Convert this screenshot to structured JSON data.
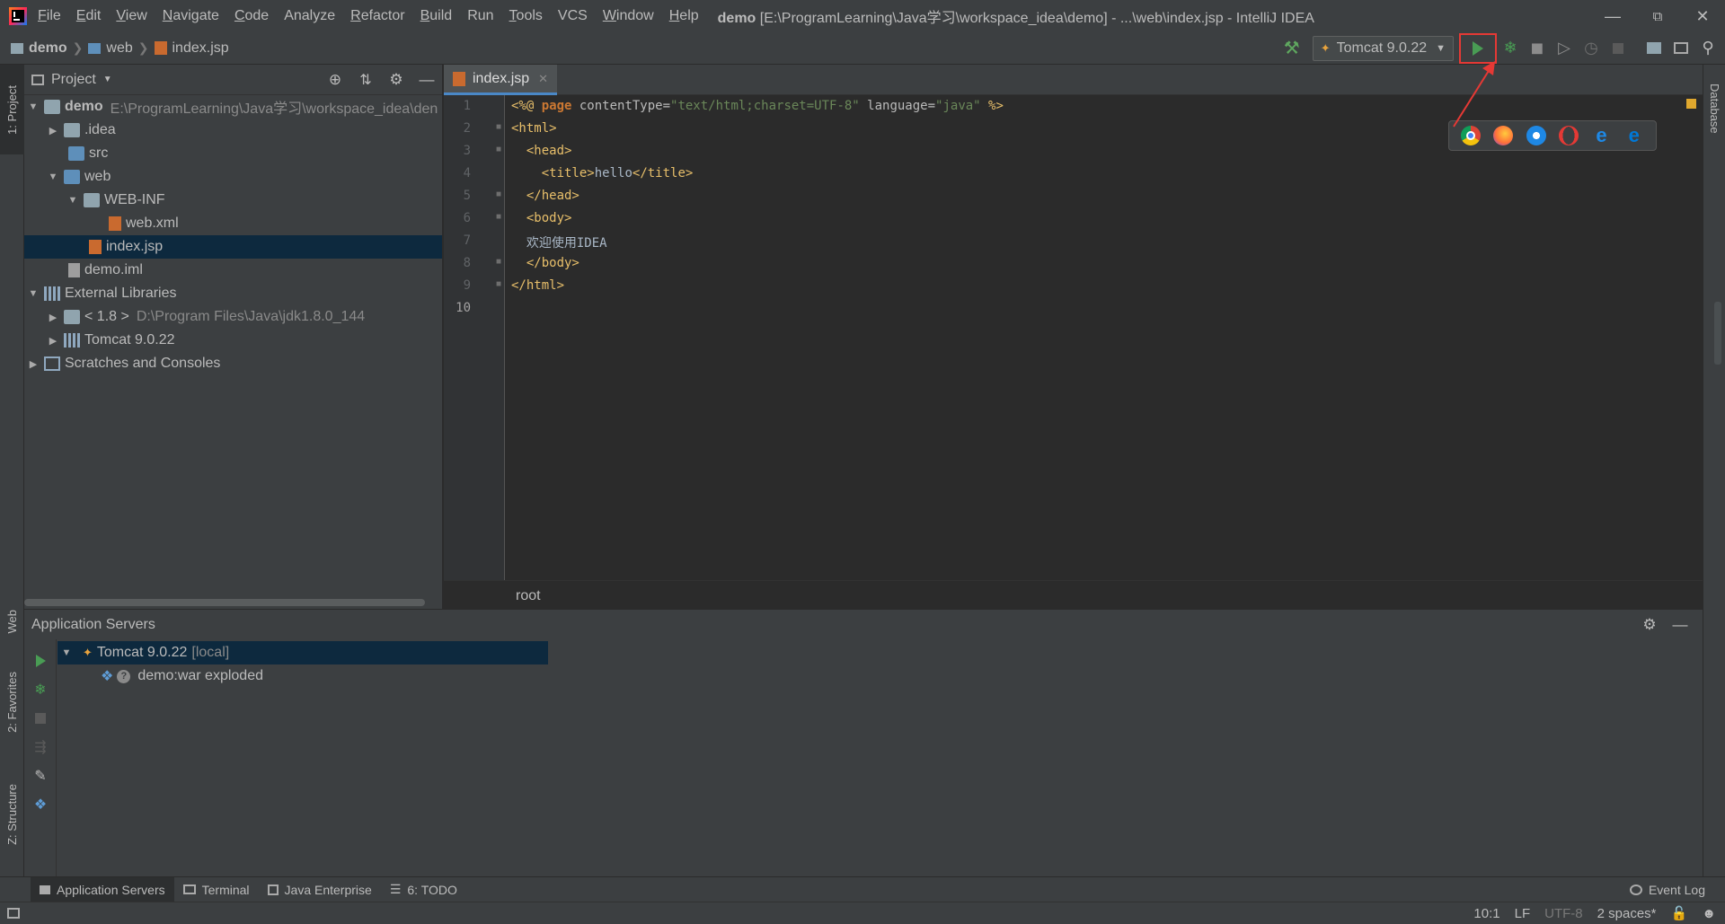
{
  "menu": {
    "items": [
      {
        "label": "File",
        "mn": "F",
        "rest": "ile"
      },
      {
        "label": "Edit",
        "mn": "E",
        "rest": "dit"
      },
      {
        "label": "View",
        "mn": "V",
        "rest": "iew"
      },
      {
        "label": "Navigate",
        "mn": "N",
        "rest": "avigate"
      },
      {
        "label": "Code",
        "mn": "C",
        "rest": "ode"
      },
      {
        "label": "Analyze",
        "mn": "",
        "rest": "Analyze"
      },
      {
        "label": "Refactor",
        "mn": "R",
        "rest": "efactor"
      },
      {
        "label": "Build",
        "mn": "B",
        "rest": "uild"
      },
      {
        "label": "Run",
        "mn": "",
        "rest": "Run"
      },
      {
        "label": "Tools",
        "mn": "T",
        "rest": "ools"
      },
      {
        "label": "VCS",
        "mn": "",
        "rest": "VCS"
      },
      {
        "label": "Window",
        "mn": "W",
        "rest": "indow"
      },
      {
        "label": "Help",
        "mn": "H",
        "rest": "elp"
      }
    ]
  },
  "window": {
    "project": "demo",
    "title_rest": "[E:\\ProgramLearning\\Java学习\\workspace_idea\\demo] - ...\\web\\index.jsp - IntelliJ IDEA"
  },
  "navbar": {
    "crumbs": [
      "demo",
      "web",
      "index.jsp"
    ],
    "run_config": "Tomcat 9.0.22"
  },
  "project_panel": {
    "title": "Project",
    "tree": {
      "demo": {
        "label": "demo",
        "path": "E:\\ProgramLearning\\Java学习\\workspace_idea\\den"
      },
      "idea": ".idea",
      "src": "src",
      "web": "web",
      "webinf": "WEB-INF",
      "webxml": "web.xml",
      "indexjsp": "index.jsp",
      "demoiml": "demo.iml",
      "extlibs": "External Libraries",
      "jdk": {
        "label": "< 1.8 >",
        "path": "D:\\Program Files\\Java\\jdk1.8.0_144"
      },
      "tomcat": "Tomcat 9.0.22",
      "scratches": "Scratches and Consoles"
    }
  },
  "editor": {
    "tab": "index.jsp",
    "line_numbers": [
      "1",
      "2",
      "3",
      "4",
      "5",
      "6",
      "7",
      "8",
      "9",
      "10"
    ],
    "code": {
      "l1": {
        "a": "<%@ ",
        "b": "page",
        "c": " contentType=",
        "d": "\"text/html;charset=UTF-8\"",
        "e": " language=",
        "f": "\"java\"",
        "g": " %>"
      },
      "l2": "<html>",
      "l3": "<head>",
      "l4": {
        "open": "<title>",
        "text": "hello",
        "close": "</title>"
      },
      "l5": "</head>",
      "l6": "<body>",
      "l7": "欢迎使用IDEA",
      "l8": "</body>",
      "l9": "</html>"
    },
    "breadcrumb": "root"
  },
  "left_stripe": [
    "1: Project",
    "Web",
    "2: Favorites",
    "Z: Structure"
  ],
  "right_stripe": [
    "Database"
  ],
  "app_servers": {
    "title": "Application Servers",
    "server": {
      "name": "Tomcat 9.0.22",
      "tag": "[local]"
    },
    "artifact": "demo:war exploded"
  },
  "bottom_tabs": [
    {
      "label": "Application Servers"
    },
    {
      "label": "Terminal"
    },
    {
      "label": "Java Enterprise"
    },
    {
      "label": "6: TODO"
    }
  ],
  "event_log": "Event Log",
  "status": {
    "position": "10:1",
    "line_sep": "LF",
    "encoding": "UTF-8",
    "indent": "2 spaces*"
  },
  "colors": {
    "accent": "#4a88c7",
    "run_green": "#499c54",
    "highlight_red": "#e53935"
  }
}
